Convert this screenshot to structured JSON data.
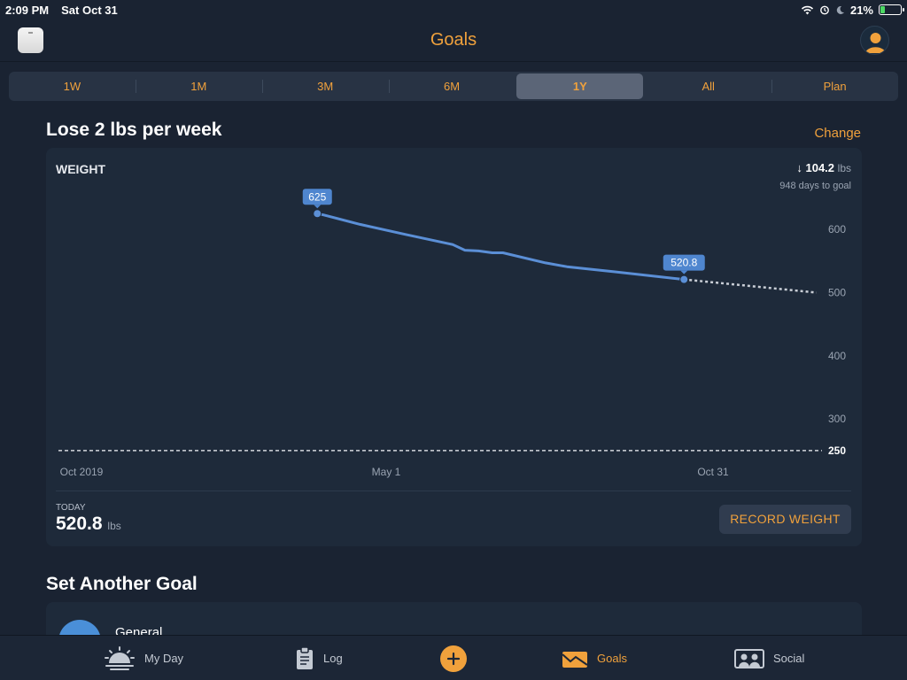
{
  "status_bar": {
    "time": "2:09 PM",
    "date": "Sat Oct 31",
    "battery": "21%"
  },
  "header": {
    "title": "Goals"
  },
  "range_tabs": [
    {
      "label": "1W",
      "active": false
    },
    {
      "label": "1M",
      "active": false
    },
    {
      "label": "3M",
      "active": false
    },
    {
      "label": "6M",
      "active": false
    },
    {
      "label": "1Y",
      "active": true
    },
    {
      "label": "All",
      "active": false
    },
    {
      "label": "Plan",
      "active": false
    }
  ],
  "goal": {
    "title": "Lose 2 lbs per week",
    "change_label": "Change"
  },
  "weight_card": {
    "label": "WEIGHT",
    "remaining_arrow": "↓",
    "remaining_value": "104.2",
    "remaining_unit": "lbs",
    "days_to_goal": "948 days to goal",
    "today_label": "TODAY",
    "today_value": "520.8",
    "today_unit": "lbs",
    "record_button": "RECORD WEIGHT"
  },
  "chart_data": {
    "type": "line",
    "x_tick_labels": [
      "Oct 2019",
      "May 1",
      "Oct 31"
    ],
    "y_ticks": [
      300,
      400,
      500,
      600
    ],
    "ylim": [
      240,
      680
    ],
    "goal_line": {
      "value": 250,
      "label": "250"
    },
    "series": [
      {
        "points": [
          {
            "x": "2020-03-04",
            "y": 625
          },
          {
            "x": "2020-03-08",
            "y": 623
          },
          {
            "x": "2020-04-01",
            "y": 608
          },
          {
            "x": "2020-05-01",
            "y": 592
          },
          {
            "x": "2020-06-01",
            "y": 576
          },
          {
            "x": "2020-06-09",
            "y": 567
          },
          {
            "x": "2020-06-18",
            "y": 566
          },
          {
            "x": "2020-06-27",
            "y": 563
          },
          {
            "x": "2020-07-04",
            "y": 563
          },
          {
            "x": "2020-08-01",
            "y": 547
          },
          {
            "x": "2020-08-15",
            "y": 541
          },
          {
            "x": "2020-09-15",
            "y": 533
          },
          {
            "x": "2020-10-31",
            "y": 520.8
          }
        ]
      }
    ],
    "projection": [
      {
        "x": "2020-10-31",
        "y": 520.8
      },
      {
        "x": "2021-01-26",
        "y": 500
      }
    ],
    "callouts": [
      {
        "x": "2020-03-04",
        "y": 625,
        "label": "625"
      },
      {
        "x": "2020-10-31",
        "y": 520.8,
        "label": "520.8"
      }
    ],
    "colors": {
      "line": "#5b8fd6",
      "projection": "#c9ced6",
      "goal_line": "#d5d8dd"
    }
  },
  "set_goal": {
    "title": "Set Another Goal",
    "option_label": "General"
  },
  "tabbar": {
    "items": [
      {
        "label": "My Day",
        "icon": "sunrise-icon"
      },
      {
        "label": "Log",
        "icon": "clipboard-icon"
      },
      {
        "label": "Goals",
        "icon": "chart-envelope-icon",
        "active": true
      },
      {
        "label": "Social",
        "icon": "people-icon"
      }
    ]
  },
  "accent_color": "#f0a13c"
}
